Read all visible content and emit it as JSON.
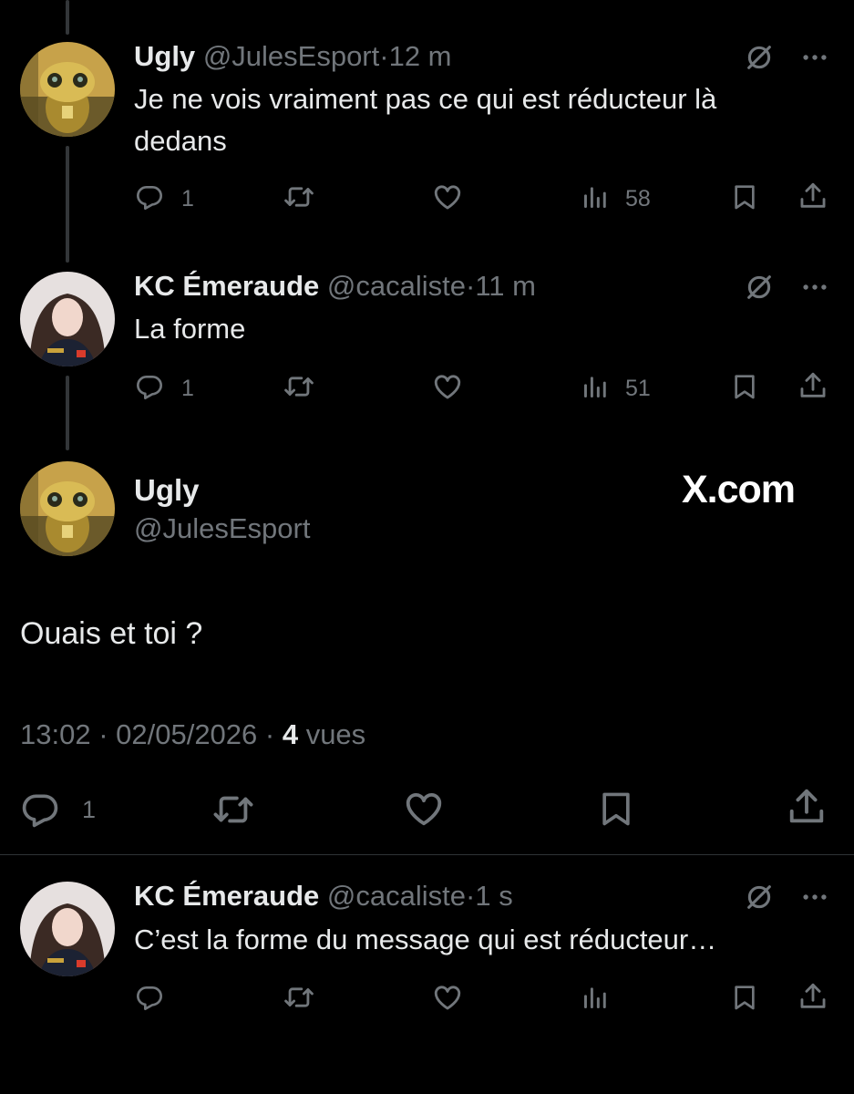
{
  "tweets": [
    {
      "author": "Ugly",
      "handle": "@JulesEsport",
      "dot": "·",
      "time": "12 m",
      "text": "Je ne vois vraiment pas ce qui est réducteur là dedans",
      "replies": "1",
      "views": "58"
    },
    {
      "author": "KC Émeraude",
      "handle": "@cacaliste",
      "dot": "·",
      "time": "11 m",
      "text": "La forme",
      "replies": "1",
      "views": "51",
      "avatar_jersey_text": "orange"
    }
  ],
  "main_tweet": {
    "author": "Ugly",
    "handle": "@JulesEsport",
    "watermark": "X.com",
    "text": "Ouais et toi ?",
    "timestamp": "13:02 · 02/05/2026 · ",
    "views_count": "4",
    "views_label": " vues",
    "replies": "1"
  },
  "reply": {
    "author": "KC Émeraude",
    "handle": "@cacaliste",
    "dot": "·",
    "time": "1 s",
    "text": "C’est la forme du message qui est réducteur…",
    "avatar_jersey_text": "orange"
  },
  "colors": {
    "background": "#000000",
    "text": "#e7e9ea",
    "secondary": "#71767b",
    "divider": "#2f3336"
  }
}
